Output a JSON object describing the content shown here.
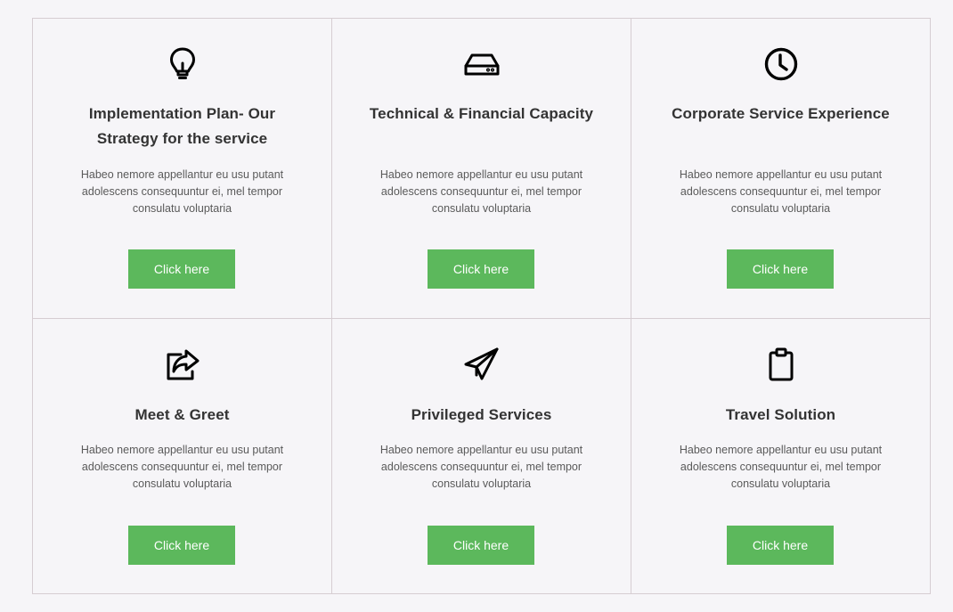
{
  "cards": [
    {
      "icon": "lightbulb-icon",
      "title": "Implementation Plan- Our Strategy for the service",
      "description": "Habeo nemore appellantur eu usu putant adolescens consequuntur ei, mel tempor consulatu voluptaria",
      "button_label": "Click here"
    },
    {
      "icon": "hard-drive-icon",
      "title": "Technical & Financial Capacity",
      "description": "Habeo nemore appellantur eu usu putant adolescens consequuntur ei, mel tempor consulatu voluptaria",
      "button_label": "Click here"
    },
    {
      "icon": "clock-icon",
      "title": "Corporate Service Experience",
      "description": "Habeo nemore appellantur eu usu putant adolescens consequuntur ei, mel tempor consulatu voluptaria",
      "button_label": "Click here"
    },
    {
      "icon": "share-icon",
      "title": "Meet & Greet",
      "description": "Habeo nemore appellantur eu usu putant adolescens consequuntur ei, mel tempor consulatu voluptaria",
      "button_label": "Click here"
    },
    {
      "icon": "paper-plane-icon",
      "title": "Privileged Services",
      "description": "Habeo nemore appellantur eu usu putant adolescens consequuntur ei, mel tempor consulatu voluptaria",
      "button_label": "Click here"
    },
    {
      "icon": "clipboard-icon",
      "title": "Travel Solution",
      "description": "Habeo nemore appellantur eu usu putant adolescens consequuntur ei, mel tempor consulatu voluptaria",
      "button_label": "Click here"
    }
  ],
  "colors": {
    "background": "#f6f5f8",
    "border": "#d6cdd2",
    "button": "#5cb85c",
    "title": "#333333",
    "text": "#5a5a5a"
  }
}
